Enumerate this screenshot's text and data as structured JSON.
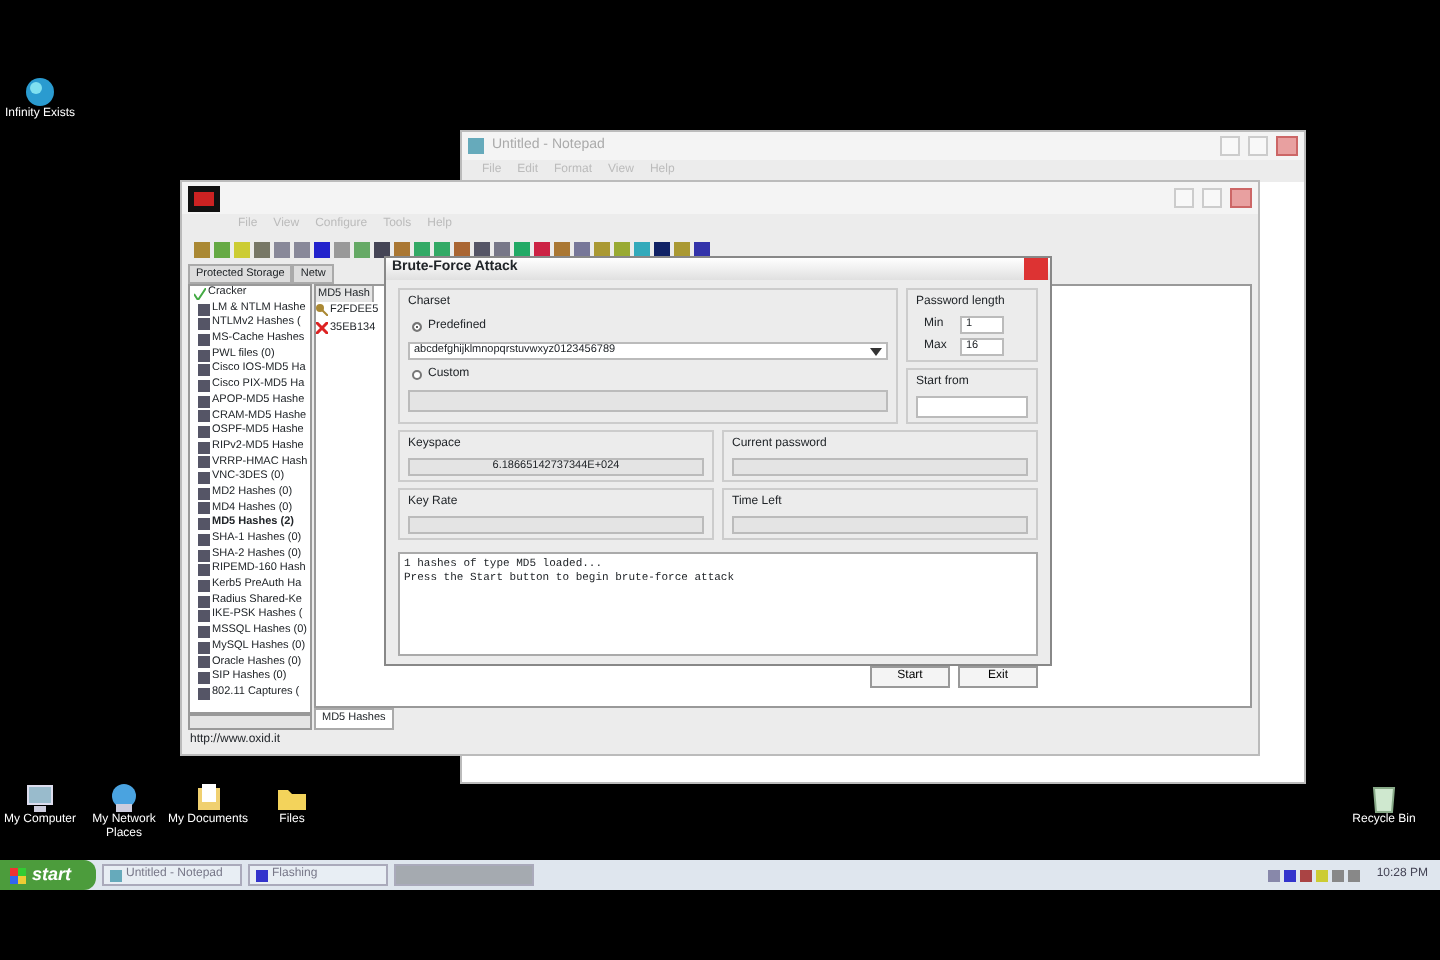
{
  "desktop": {
    "icons": [
      {
        "label": "Infinity Exists",
        "kind": "globe"
      },
      {
        "label": "My Computer",
        "kind": "computer"
      },
      {
        "label": "My Network Places",
        "kind": "network"
      },
      {
        "label": "My Documents",
        "kind": "documents"
      },
      {
        "label": "Files",
        "kind": "folder"
      },
      {
        "label": "Recycle Bin",
        "kind": "bin"
      }
    ]
  },
  "notepad": {
    "title": "Untitled - Notepad",
    "menu": [
      "File",
      "Edit",
      "Format",
      "View",
      "Help"
    ]
  },
  "cain": {
    "menu": [
      "File",
      "View",
      "Configure",
      "Tools",
      "Help"
    ],
    "tabs": [
      {
        "label": "Protected Storage",
        "selected": false
      },
      {
        "label": "Netw",
        "selected": false
      }
    ],
    "tree": {
      "label": "Cracker",
      "children": [
        {
          "label": "LM & NTLM Hashe",
          "selected": false
        },
        {
          "label": "NTLMv2 Hashes (",
          "selected": false
        },
        {
          "label": "MS-Cache Hashes",
          "selected": false
        },
        {
          "label": "PWL files (0)",
          "selected": false
        },
        {
          "label": "Cisco IOS-MD5 Ha",
          "selected": false
        },
        {
          "label": "Cisco PIX-MD5 Ha",
          "selected": false
        },
        {
          "label": "APOP-MD5 Hashe",
          "selected": false
        },
        {
          "label": "CRAM-MD5 Hashe",
          "selected": false
        },
        {
          "label": "OSPF-MD5 Hashe",
          "selected": false
        },
        {
          "label": "RIPv2-MD5 Hashe",
          "selected": false
        },
        {
          "label": "VRRP-HMAC Hash",
          "selected": false
        },
        {
          "label": "VNC-3DES (0)",
          "selected": false
        },
        {
          "label": "MD2 Hashes (0)",
          "selected": false
        },
        {
          "label": "MD4 Hashes (0)",
          "selected": false
        },
        {
          "label": "MD5 Hashes (2)",
          "selected": true
        },
        {
          "label": "SHA-1 Hashes (0)",
          "selected": false
        },
        {
          "label": "SHA-2 Hashes (0)",
          "selected": false
        },
        {
          "label": "RIPEMD-160 Hash",
          "selected": false
        },
        {
          "label": "Kerb5 PreAuth Ha",
          "selected": false
        },
        {
          "label": "Radius Shared-Ke",
          "selected": false
        },
        {
          "label": "IKE-PSK Hashes (",
          "selected": false
        },
        {
          "label": "MSSQL Hashes (0)",
          "selected": false
        },
        {
          "label": "MySQL Hashes (0)",
          "selected": false
        },
        {
          "label": "Oracle Hashes (0)",
          "selected": false
        },
        {
          "label": "SIP Hashes (0)",
          "selected": false
        },
        {
          "label": "802.11 Captures (",
          "selected": false
        }
      ]
    },
    "list": {
      "columns": [
        "MD5 Hash"
      ],
      "rows": [
        {
          "hash": "F2FDEE5",
          "kind": "key"
        },
        {
          "hash": "35EB134",
          "kind": "cross"
        }
      ]
    },
    "bottom_tab": "MD5 Hashes",
    "status": "http://www.oxid.it"
  },
  "dialog": {
    "title": "Brute-Force Attack",
    "charset": {
      "label": "Charset",
      "options": [
        {
          "label": "Predefined",
          "selected": true
        },
        {
          "label": "Custom",
          "selected": false
        }
      ],
      "predefined_value": "abcdefghijklmnopqrstuvwxyz0123456789"
    },
    "password_length": {
      "label": "Password length",
      "min_label": "Min",
      "min": "1",
      "max_label": "Max",
      "max": "16"
    },
    "start_from": {
      "label": "Start from"
    },
    "keyspace": {
      "label": "Keyspace",
      "value": "6.18665142737344E+024"
    },
    "current_password": {
      "label": "Current password"
    },
    "key_rate": {
      "label": "Key Rate"
    },
    "time_left": {
      "label": "Time Left"
    },
    "log": [
      "1 hashes of type MD5 loaded...",
      "Press the Start button to begin brute-force attack"
    ],
    "buttons": [
      "Start",
      "Exit"
    ]
  },
  "taskbar": {
    "start": "start",
    "tasks": [
      {
        "label": "Untitled - Notepad",
        "kind": "notepad",
        "selected": false
      },
      {
        "label": "Flashing",
        "kind": "app",
        "selected": false
      },
      {
        "kind": "blank",
        "selected": true
      }
    ],
    "clock": "10:28 PM"
  }
}
